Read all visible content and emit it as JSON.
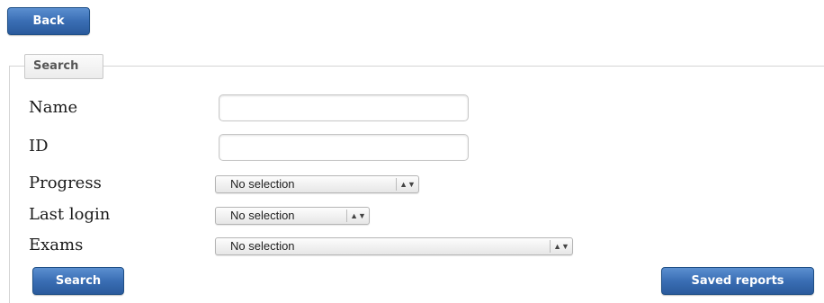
{
  "toolbar": {
    "back_label": "Back"
  },
  "search_section": {
    "legend": "Search",
    "fields": {
      "name": {
        "label": "Name",
        "value": "",
        "placeholder": ""
      },
      "id": {
        "label": "ID",
        "value": "",
        "placeholder": ""
      },
      "progress": {
        "label": "Progress",
        "selected": "No selection"
      },
      "last_login": {
        "label": "Last login",
        "selected": "No selection"
      },
      "exams": {
        "label": "Exams",
        "selected": "No selection"
      }
    },
    "search_label": "Search",
    "saved_reports_label": "Saved reports"
  },
  "icons": {
    "select_arrow": "up-down-chevron-icon"
  },
  "colors": {
    "button_primary": "#3a6eb4",
    "button_border": "#1f4f86",
    "button_text": "#ffffff",
    "fieldset_border": "#d4d4d4",
    "label_text": "#1a1a1a"
  }
}
